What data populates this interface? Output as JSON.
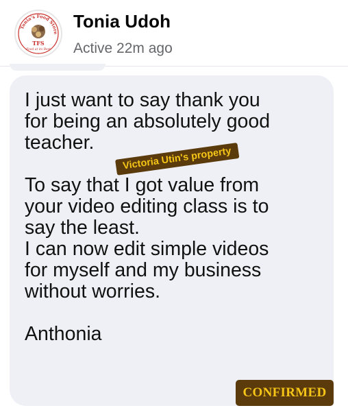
{
  "header": {
    "contact_name": "Tonia Udoh",
    "status": "Active 22m ago",
    "avatar_logo": {
      "arc_text": "Tonia's Food Store",
      "monogram": "TFS",
      "tagline": "Food at its Best"
    }
  },
  "message": {
    "text": "I just want to say thank you\nfor being an absolutely good\nteacher.\n\nTo say that I got value from\nyour video editing class is to\nsay the least.\nI can now edit simple videos\nfor myself and my business\nwithout worries.\n\nAnthonia"
  },
  "overlays": {
    "watermark": "Victoria Utin's property",
    "confirmed": "CONFIRMED"
  },
  "colors": {
    "bubble": "#eff0f5",
    "badge_bg": "#5b3b0c",
    "badge_text": "#f5c518",
    "secondary_text": "#65676b"
  }
}
